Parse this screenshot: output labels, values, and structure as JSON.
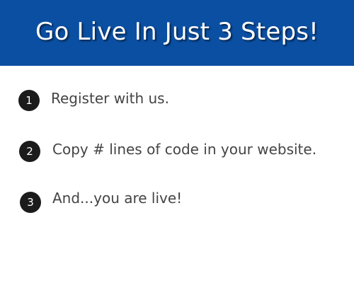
{
  "header": {
    "title": "Go Live In Just 3 Steps!"
  },
  "steps": [
    {
      "number": "1",
      "text": "Register with us."
    },
    {
      "number": "2",
      "text": "Copy # lines of code in your website."
    },
    {
      "number": "3",
      "text": "And...you are live!"
    }
  ],
  "colors": {
    "header_background": "#0b4fa2",
    "header_text": "#ffffff",
    "badge_background": "#1b1b1b",
    "badge_text": "#ffffff",
    "step_text": "#444444",
    "page_background": "#ffffff"
  }
}
